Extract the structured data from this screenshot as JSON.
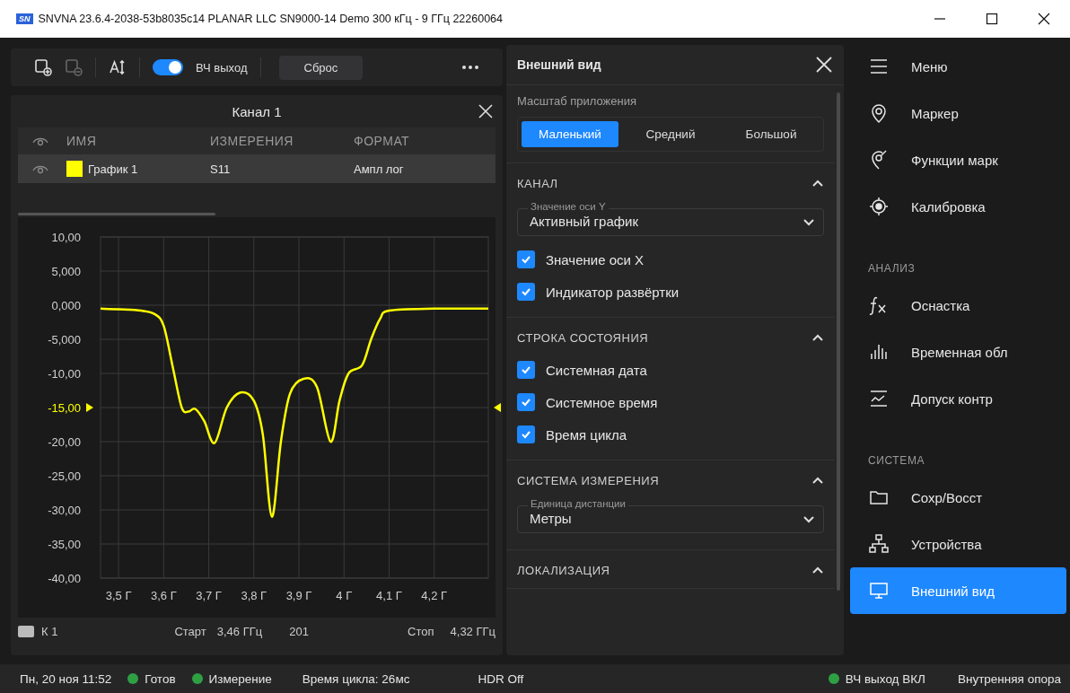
{
  "window": {
    "title": "SNVNA 23.6.4-2038-53b8035c14 PLANAR LLC SN9000-14 Demo 300 кГц - 9 ГГц 22260064",
    "logo": "SN"
  },
  "toolbar": {
    "rf_output": {
      "label": "ВЧ выход",
      "on": true
    },
    "reset_button": "Сброс"
  },
  "channel_panel": {
    "title": "Канал 1",
    "table": {
      "columns": [
        "ИМЯ",
        "ИЗМЕРЕНИЯ",
        "ФОРМАТ"
      ],
      "rows": [
        {
          "name": "График 1",
          "color": "#ffff00",
          "measurement": "S11",
          "format": "Ампл лог",
          "selected": true
        }
      ]
    },
    "chart_data": {
      "type": "line",
      "xlim": [
        3.46,
        4.32
      ],
      "ylim": [
        -40,
        10
      ],
      "xticks": [
        {
          "value": 3.5,
          "label": "3,5 Г"
        },
        {
          "value": 3.6,
          "label": "3,6 Г"
        },
        {
          "value": 3.7,
          "label": "3,7 Г"
        },
        {
          "value": 3.8,
          "label": "3,8 Г"
        },
        {
          "value": 3.9,
          "label": "3,9 Г"
        },
        {
          "value": 4.0,
          "label": "4 Г"
        },
        {
          "value": 4.1,
          "label": "4,1 Г"
        },
        {
          "value": 4.2,
          "label": "4,2 Г"
        }
      ],
      "yticks": [
        {
          "value": 10,
          "label": "10,00"
        },
        {
          "value": 5,
          "label": "5,000"
        },
        {
          "value": 0,
          "label": "0,000"
        },
        {
          "value": -5,
          "label": "-5,000"
        },
        {
          "value": -10,
          "label": "-10,00"
        },
        {
          "value": -20,
          "label": "-20,00"
        },
        {
          "value": -25,
          "label": "-25,00"
        },
        {
          "value": -30,
          "label": "-30,00"
        },
        {
          "value": -35,
          "label": "-35,00"
        },
        {
          "value": -40,
          "label": "-40,00"
        }
      ],
      "x": [
        3.46,
        3.5,
        3.55,
        3.58,
        3.6,
        3.62,
        3.64,
        3.655,
        3.67,
        3.69,
        3.713,
        3.74,
        3.77,
        3.8,
        3.82,
        3.84,
        3.86,
        3.88,
        3.91,
        3.94,
        3.97,
        3.99,
        4.01,
        4.04,
        4.06,
        4.08,
        4.1,
        4.2,
        4.32
      ],
      "series": [
        {
          "color": "#ffff00",
          "values": [
            -0.5,
            -0.6,
            -0.8,
            -1.3,
            -3,
            -9,
            -15,
            -15.6,
            -15.2,
            -17,
            -20.2,
            -15,
            -12.8,
            -14,
            -19,
            -31,
            -20,
            -13,
            -10.8,
            -12,
            -20,
            -14,
            -10,
            -8.8,
            -5,
            -2,
            -0.8,
            -0.5,
            -0.5
          ]
        }
      ],
      "grid": true,
      "annotations": [
        "-15,00"
      ]
    },
    "channel_bar": {
      "channel": "К 1",
      "start_label": "Старт",
      "start": "3,46 ГГц",
      "points": "201",
      "stop_label": "Стоп",
      "stop": "4,32 ГГц"
    }
  },
  "settings_panel": {
    "title": "Внешний вид",
    "scale": {
      "label": "Масштаб приложения",
      "options": [
        {
          "label": "Маленький",
          "selected": true
        },
        {
          "label": "Средний",
          "selected": false
        },
        {
          "label": "Большой",
          "selected": false
        }
      ]
    },
    "sections": [
      {
        "title": "КАНАЛ",
        "expanded": true,
        "items": [
          {
            "kind": "dropdown",
            "label": "Значение оси Y",
            "value": "Активный график"
          },
          {
            "kind": "checkbox",
            "label": "Значение оси X",
            "checked": true
          },
          {
            "kind": "checkbox",
            "label": "Индикатор развёртки",
            "checked": true
          }
        ]
      },
      {
        "title": "СТРОКА СОСТОЯНИЯ",
        "expanded": true,
        "items": [
          {
            "kind": "checkbox",
            "label": "Системная дата",
            "checked": true
          },
          {
            "kind": "checkbox",
            "label": "Системное время",
            "checked": true
          },
          {
            "kind": "checkbox",
            "label": "Время цикла",
            "checked": true
          }
        ]
      },
      {
        "title": "СИСТЕМА ИЗМЕРЕНИЯ",
        "expanded": true,
        "items": [
          {
            "kind": "dropdown",
            "label": "Единица дистанции",
            "value": "Метры"
          }
        ]
      },
      {
        "title": "ЛОКАЛИЗАЦИЯ",
        "expanded": true
      }
    ]
  },
  "nav": {
    "groups": [
      {
        "items": [
          {
            "label": "Меню",
            "selected": false
          },
          {
            "label": "Маркер",
            "selected": false
          },
          {
            "label": "Функции марк",
            "selected": false
          },
          {
            "label": "Калибровка",
            "selected": false
          }
        ]
      },
      {
        "header": "АНАЛИЗ",
        "items": [
          {
            "label": "Оснастка",
            "selected": false
          },
          {
            "label": "Временная обл",
            "selected": false
          },
          {
            "label": "Допуск контр",
            "selected": false
          }
        ]
      },
      {
        "header": "СИСТЕМА",
        "items": [
          {
            "label": "Сохр/Восст",
            "selected": false
          },
          {
            "label": "Устройства",
            "selected": false
          },
          {
            "label": "Внешний вид",
            "selected": true
          }
        ]
      }
    ]
  },
  "status_bar": {
    "datetime": "Пн, 20 ноя 11:52",
    "indicators": [
      {
        "label": "Готов",
        "color": "#2ea043"
      },
      {
        "label": "Измерение",
        "color": "#2ea043"
      }
    ],
    "cycle_time": "Время цикла: 26мс",
    "hdr": "HDR Off",
    "rf_state": {
      "label": "ВЧ выход ВКЛ",
      "color": "#2ea043"
    },
    "reference": "Внутренняя опора"
  }
}
